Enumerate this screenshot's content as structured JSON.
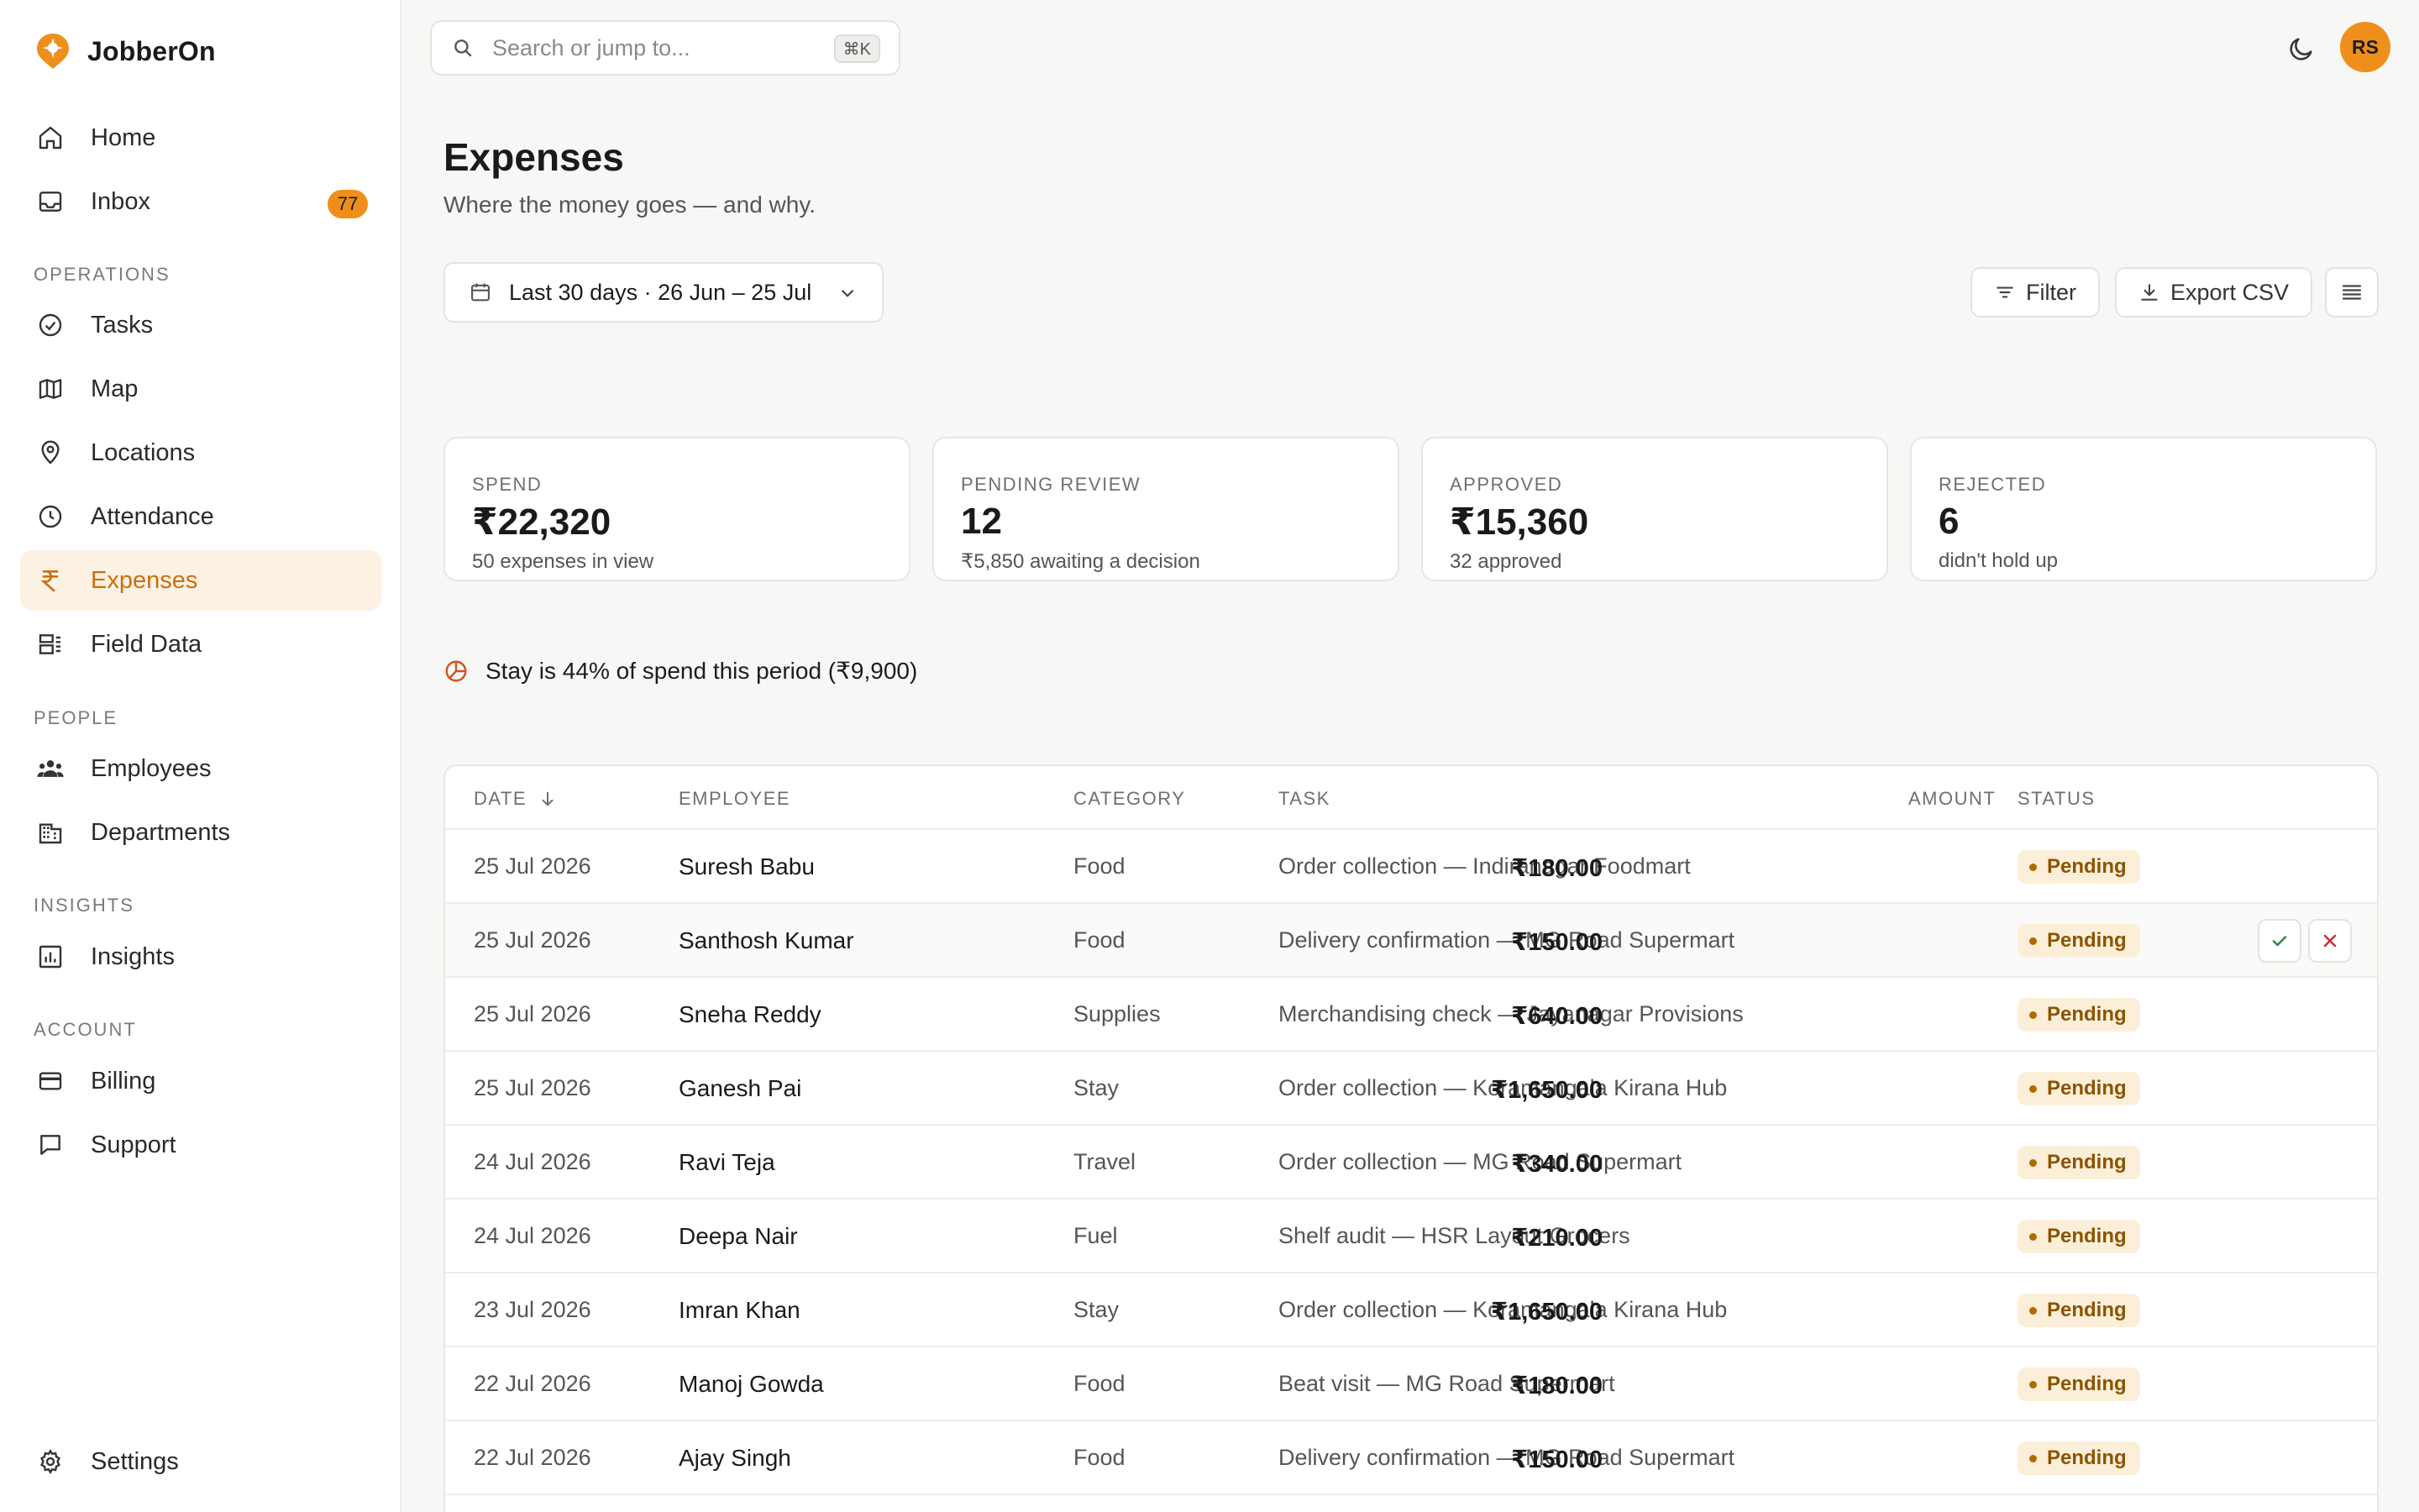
{
  "app": {
    "name": "JobberOn"
  },
  "sidebar": {
    "top_items": [
      {
        "label": "Home",
        "icon": "home-icon"
      },
      {
        "label": "Inbox",
        "icon": "inbox-icon",
        "badge": "77"
      }
    ],
    "sections": [
      {
        "label": "OPERATIONS",
        "items": [
          {
            "label": "Tasks",
            "icon": "check-circle-icon"
          },
          {
            "label": "Map",
            "icon": "map-icon"
          },
          {
            "label": "Locations",
            "icon": "pin-icon"
          },
          {
            "label": "Attendance",
            "icon": "clock-icon"
          },
          {
            "label": "Expenses",
            "icon": "rupee-icon",
            "active": true
          },
          {
            "label": "Field Data",
            "icon": "field-data-icon"
          }
        ]
      },
      {
        "label": "PEOPLE",
        "items": [
          {
            "label": "Employees",
            "icon": "people-icon"
          },
          {
            "label": "Departments",
            "icon": "building-icon"
          }
        ]
      },
      {
        "label": "INSIGHTS",
        "items": [
          {
            "label": "Insights",
            "icon": "chart-icon"
          }
        ]
      },
      {
        "label": "ACCOUNT",
        "items": [
          {
            "label": "Billing",
            "icon": "card-icon"
          },
          {
            "label": "Support",
            "icon": "chat-icon"
          }
        ]
      }
    ],
    "settings": {
      "label": "Settings",
      "icon": "gear-icon"
    }
  },
  "topbar": {
    "search_placeholder": "Search or jump to...",
    "search_shortcut": "⌘K",
    "avatar_initials": "RS"
  },
  "header": {
    "title": "Expenses",
    "subtitle": "Where the money goes — and why.",
    "date_range": "Last 30 days · 26 Jun – 25 Jul",
    "filter_label": "Filter",
    "export_label": "Export CSV"
  },
  "stats": [
    {
      "label": "SPEND",
      "value": "₹22,320",
      "sub": "50 expenses in view"
    },
    {
      "label": "PENDING REVIEW",
      "value": "12",
      "sub": "₹5,850 awaiting a decision"
    },
    {
      "label": "APPROVED",
      "value": "₹15,360",
      "sub": "32 approved"
    },
    {
      "label": "REJECTED",
      "value": "6",
      "sub": "didn't hold up"
    }
  ],
  "insight": {
    "text": "Stay is 44% of spend this period (₹9,900)"
  },
  "table": {
    "columns": {
      "date": "DATE",
      "employee": "EMPLOYEE",
      "category": "CATEGORY",
      "task": "TASK",
      "amount": "AMOUNT",
      "status": "STATUS"
    },
    "rows": [
      {
        "date": "25 Jul 2026",
        "employee": "Suresh Babu",
        "category": "Food",
        "task": "Order collection — Indiranagar Foodmart",
        "amount": "₹180.00",
        "status": "Pending"
      },
      {
        "date": "25 Jul 2026",
        "employee": "Santhosh Kumar",
        "category": "Food",
        "task": "Delivery confirmation — MG Road Supermart",
        "amount": "₹150.00",
        "status": "Pending"
      },
      {
        "date": "25 Jul 2026",
        "employee": "Sneha Reddy",
        "category": "Supplies",
        "task": "Merchandising check — Jayanagar Provisions",
        "amount": "₹640.00",
        "status": "Pending"
      },
      {
        "date": "25 Jul 2026",
        "employee": "Ganesh Pai",
        "category": "Stay",
        "task": "Order collection — Koramangala Kirana Hub",
        "amount": "₹1,650.00",
        "status": "Pending"
      },
      {
        "date": "24 Jul 2026",
        "employee": "Ravi Teja",
        "category": "Travel",
        "task": "Order collection — MG Road Supermart",
        "amount": "₹340.00",
        "status": "Pending"
      },
      {
        "date": "24 Jul 2026",
        "employee": "Deepa Nair",
        "category": "Fuel",
        "task": "Shelf audit — HSR Layout Grocers",
        "amount": "₹210.00",
        "status": "Pending"
      },
      {
        "date": "23 Jul 2026",
        "employee": "Imran Khan",
        "category": "Stay",
        "task": "Order collection — Koramangala Kirana Hub",
        "amount": "₹1,650.00",
        "status": "Pending"
      },
      {
        "date": "22 Jul 2026",
        "employee": "Manoj Gowda",
        "category": "Food",
        "task": "Beat visit — MG Road Supermart",
        "amount": "₹180.00",
        "status": "Pending"
      },
      {
        "date": "22 Jul 2026",
        "employee": "Ajay Singh",
        "category": "Food",
        "task": "Delivery confirmation — MG Road Supermart",
        "amount": "₹150.00",
        "status": "Pending"
      }
    ]
  },
  "colors": {
    "accent": "#ef8f1b",
    "active_bg": "#fdf1e4",
    "pending_bg": "#fcefd9",
    "pending_text": "#8a5400"
  }
}
